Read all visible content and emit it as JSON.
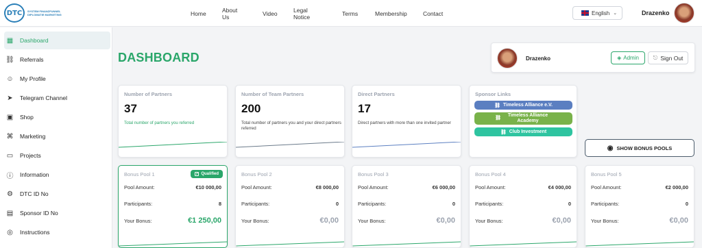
{
  "brand": {
    "mark": "DTC",
    "tagline": "SYSTEM FINANZFUNNEL DIPLOMATIE MARKETING"
  },
  "nav": {
    "items": [
      "Home",
      "About Us",
      "Video",
      "Legal Notice",
      "Terms",
      "Membership",
      "Contact"
    ]
  },
  "language": {
    "label": "English"
  },
  "user": {
    "name": "Drazenko"
  },
  "sidebar": {
    "items": [
      {
        "label": "Dashboard",
        "icon": "dashboard-icon"
      },
      {
        "label": "Referrals",
        "icon": "link-icon"
      },
      {
        "label": "My Profile",
        "icon": "user-icon"
      },
      {
        "label": "Telegram Channel",
        "icon": "telegram-icon"
      },
      {
        "label": "Shop",
        "icon": "shop-icon"
      },
      {
        "label": "Marketing",
        "icon": "marketing-icon"
      },
      {
        "label": "Projects",
        "icon": "folder-icon"
      },
      {
        "label": "Information",
        "icon": "info-icon"
      },
      {
        "label": "DTC ID No",
        "icon": "id-icon"
      },
      {
        "label": "Sponsor ID No",
        "icon": "sponsor-id-icon"
      },
      {
        "label": "Instructions",
        "icon": "instructions-icon"
      }
    ]
  },
  "page": {
    "title": "DASHBOARD"
  },
  "user_card": {
    "name": "Drazenko",
    "admin_label": "Admin",
    "signout_label": "Sign Out"
  },
  "stats": [
    {
      "label": "Number of Partners",
      "value": "37",
      "desc": "Total number of partners you referred"
    },
    {
      "label": "Number of Team Partners",
      "value": "200",
      "desc": "Total number of partners you and your direct partners referred"
    },
    {
      "label": "Direct Partners",
      "value": "17",
      "desc": "Direct partners with more than one invited partner"
    }
  ],
  "sponsor": {
    "label": "Sponsor Links",
    "links": [
      {
        "label": "Timeless Alliance e.V.",
        "color": "#5b7fc1"
      },
      {
        "label": "Timeless Alliance Academy",
        "color": "#79b24a"
      },
      {
        "label": "Club Investment",
        "color": "#2ec4a0"
      }
    ]
  },
  "bonus_button": {
    "label": "SHOW BONUS POOLS"
  },
  "pools": [
    {
      "title": "Bonus Pool 1",
      "badge": "Qualified",
      "amount_label": "Pool Amount:",
      "amount": "€10 000,00",
      "participants_label": "Participants:",
      "participants": "8",
      "bonus_label": "Your Bonus:",
      "bonus": "€1 250,00"
    },
    {
      "title": "Bonus Pool 2",
      "amount_label": "Pool Amount:",
      "amount": "€8 000,00",
      "participants_label": "Participants:",
      "participants": "0",
      "bonus_label": "Your Bonus:",
      "bonus": "€0,00"
    },
    {
      "title": "Bonus Pool 3",
      "amount_label": "Pool Amount:",
      "amount": "€6 000,00",
      "participants_label": "Participants:",
      "participants": "0",
      "bonus_label": "Your Bonus:",
      "bonus": "€0,00"
    },
    {
      "title": "Bonus Pool 4",
      "amount_label": "Pool Amount:",
      "amount": "€4 000,00",
      "participants_label": "Participants:",
      "participants": "0",
      "bonus_label": "Your Bonus:",
      "bonus": "€0,00"
    },
    {
      "title": "Bonus Pool 5",
      "amount_label": "Pool Amount:",
      "amount": "€2 000,00",
      "participants_label": "Participants:",
      "participants": "0",
      "bonus_label": "Your Bonus:",
      "bonus": "€0,00"
    }
  ],
  "colors": {
    "accent": "#2aa66a",
    "brand_blue": "#2a7fb8",
    "muted": "#9ca3af"
  }
}
